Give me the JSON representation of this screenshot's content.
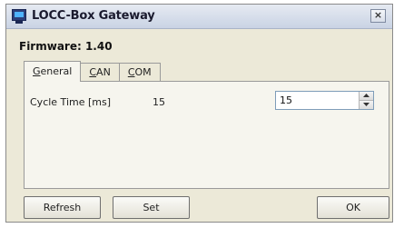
{
  "window": {
    "title": "LOCC-Box Gateway",
    "close_label": "×"
  },
  "firmware": {
    "label": "Firmware: 1.40"
  },
  "tabs": [
    {
      "label_underlined": "G",
      "label_rest": "eneral",
      "active": true
    },
    {
      "label_underlined": "C",
      "label_rest": "AN",
      "active": false
    },
    {
      "label_underlined": "C",
      "label_rest": "OM",
      "active": false
    }
  ],
  "general": {
    "cycle_time_label": "Cycle Time [ms]",
    "cycle_time_value": "15",
    "cycle_time_input": "15"
  },
  "buttons": {
    "refresh": "Refresh",
    "set": "Set",
    "ok": "OK"
  },
  "icons": {
    "app": "monitor-icon",
    "close": "close-icon",
    "spin_up": "arrow-up-icon",
    "spin_down": "arrow-down-icon"
  }
}
